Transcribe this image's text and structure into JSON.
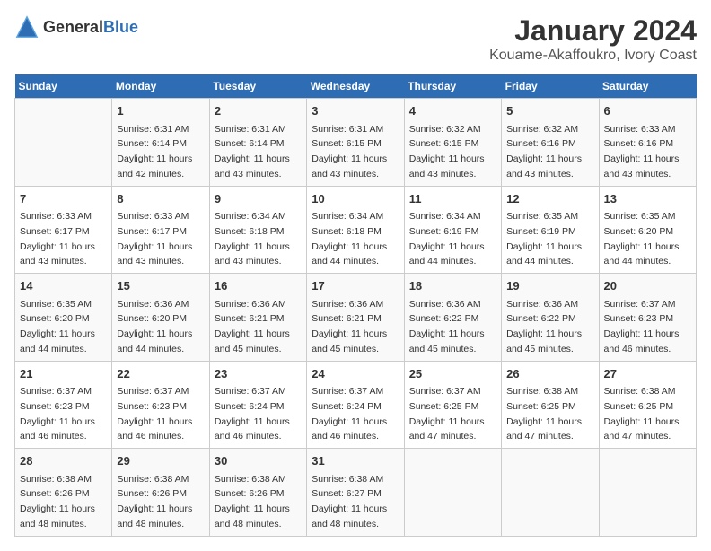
{
  "logo": {
    "general": "General",
    "blue": "Blue"
  },
  "title": "January 2024",
  "subtitle": "Kouame-Akaffoukro, Ivory Coast",
  "weekdays": [
    "Sunday",
    "Monday",
    "Tuesday",
    "Wednesday",
    "Thursday",
    "Friday",
    "Saturday"
  ],
  "weeks": [
    [
      {
        "day": "",
        "sunrise": "",
        "sunset": "",
        "daylight": ""
      },
      {
        "day": "1",
        "sunrise": "Sunrise: 6:31 AM",
        "sunset": "Sunset: 6:14 PM",
        "daylight": "Daylight: 11 hours and 42 minutes."
      },
      {
        "day": "2",
        "sunrise": "Sunrise: 6:31 AM",
        "sunset": "Sunset: 6:14 PM",
        "daylight": "Daylight: 11 hours and 43 minutes."
      },
      {
        "day": "3",
        "sunrise": "Sunrise: 6:31 AM",
        "sunset": "Sunset: 6:15 PM",
        "daylight": "Daylight: 11 hours and 43 minutes."
      },
      {
        "day": "4",
        "sunrise": "Sunrise: 6:32 AM",
        "sunset": "Sunset: 6:15 PM",
        "daylight": "Daylight: 11 hours and 43 minutes."
      },
      {
        "day": "5",
        "sunrise": "Sunrise: 6:32 AM",
        "sunset": "Sunset: 6:16 PM",
        "daylight": "Daylight: 11 hours and 43 minutes."
      },
      {
        "day": "6",
        "sunrise": "Sunrise: 6:33 AM",
        "sunset": "Sunset: 6:16 PM",
        "daylight": "Daylight: 11 hours and 43 minutes."
      }
    ],
    [
      {
        "day": "7",
        "sunrise": "Sunrise: 6:33 AM",
        "sunset": "Sunset: 6:17 PM",
        "daylight": "Daylight: 11 hours and 43 minutes."
      },
      {
        "day": "8",
        "sunrise": "Sunrise: 6:33 AM",
        "sunset": "Sunset: 6:17 PM",
        "daylight": "Daylight: 11 hours and 43 minutes."
      },
      {
        "day": "9",
        "sunrise": "Sunrise: 6:34 AM",
        "sunset": "Sunset: 6:18 PM",
        "daylight": "Daylight: 11 hours and 43 minutes."
      },
      {
        "day": "10",
        "sunrise": "Sunrise: 6:34 AM",
        "sunset": "Sunset: 6:18 PM",
        "daylight": "Daylight: 11 hours and 44 minutes."
      },
      {
        "day": "11",
        "sunrise": "Sunrise: 6:34 AM",
        "sunset": "Sunset: 6:19 PM",
        "daylight": "Daylight: 11 hours and 44 minutes."
      },
      {
        "day": "12",
        "sunrise": "Sunrise: 6:35 AM",
        "sunset": "Sunset: 6:19 PM",
        "daylight": "Daylight: 11 hours and 44 minutes."
      },
      {
        "day": "13",
        "sunrise": "Sunrise: 6:35 AM",
        "sunset": "Sunset: 6:20 PM",
        "daylight": "Daylight: 11 hours and 44 minutes."
      }
    ],
    [
      {
        "day": "14",
        "sunrise": "Sunrise: 6:35 AM",
        "sunset": "Sunset: 6:20 PM",
        "daylight": "Daylight: 11 hours and 44 minutes."
      },
      {
        "day": "15",
        "sunrise": "Sunrise: 6:36 AM",
        "sunset": "Sunset: 6:20 PM",
        "daylight": "Daylight: 11 hours and 44 minutes."
      },
      {
        "day": "16",
        "sunrise": "Sunrise: 6:36 AM",
        "sunset": "Sunset: 6:21 PM",
        "daylight": "Daylight: 11 hours and 45 minutes."
      },
      {
        "day": "17",
        "sunrise": "Sunrise: 6:36 AM",
        "sunset": "Sunset: 6:21 PM",
        "daylight": "Daylight: 11 hours and 45 minutes."
      },
      {
        "day": "18",
        "sunrise": "Sunrise: 6:36 AM",
        "sunset": "Sunset: 6:22 PM",
        "daylight": "Daylight: 11 hours and 45 minutes."
      },
      {
        "day": "19",
        "sunrise": "Sunrise: 6:36 AM",
        "sunset": "Sunset: 6:22 PM",
        "daylight": "Daylight: 11 hours and 45 minutes."
      },
      {
        "day": "20",
        "sunrise": "Sunrise: 6:37 AM",
        "sunset": "Sunset: 6:23 PM",
        "daylight": "Daylight: 11 hours and 46 minutes."
      }
    ],
    [
      {
        "day": "21",
        "sunrise": "Sunrise: 6:37 AM",
        "sunset": "Sunset: 6:23 PM",
        "daylight": "Daylight: 11 hours and 46 minutes."
      },
      {
        "day": "22",
        "sunrise": "Sunrise: 6:37 AM",
        "sunset": "Sunset: 6:23 PM",
        "daylight": "Daylight: 11 hours and 46 minutes."
      },
      {
        "day": "23",
        "sunrise": "Sunrise: 6:37 AM",
        "sunset": "Sunset: 6:24 PM",
        "daylight": "Daylight: 11 hours and 46 minutes."
      },
      {
        "day": "24",
        "sunrise": "Sunrise: 6:37 AM",
        "sunset": "Sunset: 6:24 PM",
        "daylight": "Daylight: 11 hours and 46 minutes."
      },
      {
        "day": "25",
        "sunrise": "Sunrise: 6:37 AM",
        "sunset": "Sunset: 6:25 PM",
        "daylight": "Daylight: 11 hours and 47 minutes."
      },
      {
        "day": "26",
        "sunrise": "Sunrise: 6:38 AM",
        "sunset": "Sunset: 6:25 PM",
        "daylight": "Daylight: 11 hours and 47 minutes."
      },
      {
        "day": "27",
        "sunrise": "Sunrise: 6:38 AM",
        "sunset": "Sunset: 6:25 PM",
        "daylight": "Daylight: 11 hours and 47 minutes."
      }
    ],
    [
      {
        "day": "28",
        "sunrise": "Sunrise: 6:38 AM",
        "sunset": "Sunset: 6:26 PM",
        "daylight": "Daylight: 11 hours and 48 minutes."
      },
      {
        "day": "29",
        "sunrise": "Sunrise: 6:38 AM",
        "sunset": "Sunset: 6:26 PM",
        "daylight": "Daylight: 11 hours and 48 minutes."
      },
      {
        "day": "30",
        "sunrise": "Sunrise: 6:38 AM",
        "sunset": "Sunset: 6:26 PM",
        "daylight": "Daylight: 11 hours and 48 minutes."
      },
      {
        "day": "31",
        "sunrise": "Sunrise: 6:38 AM",
        "sunset": "Sunset: 6:27 PM",
        "daylight": "Daylight: 11 hours and 48 minutes."
      },
      {
        "day": "",
        "sunrise": "",
        "sunset": "",
        "daylight": ""
      },
      {
        "day": "",
        "sunrise": "",
        "sunset": "",
        "daylight": ""
      },
      {
        "day": "",
        "sunrise": "",
        "sunset": "",
        "daylight": ""
      }
    ]
  ]
}
